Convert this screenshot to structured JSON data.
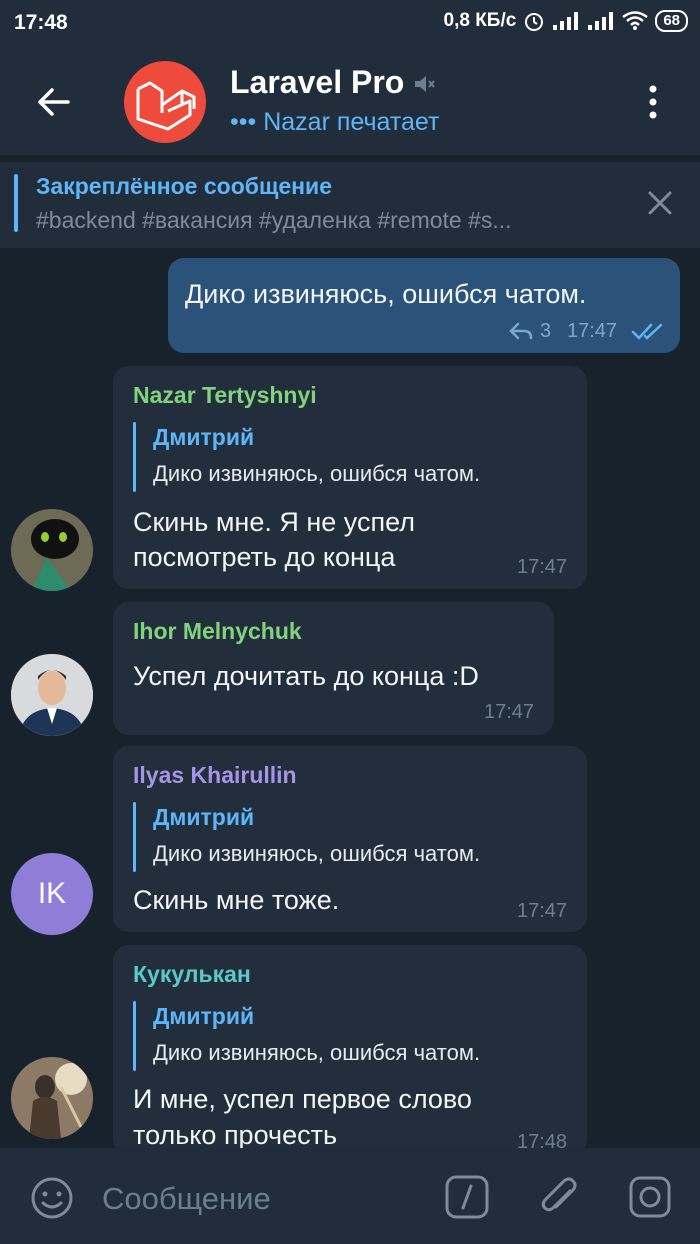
{
  "status_bar": {
    "time": "17:48",
    "net_speed": "0,8 КБ/с",
    "battery": "68"
  },
  "header": {
    "title": "Laravel Pro",
    "status": "••• Nazar печатает"
  },
  "pinned": {
    "title": "Закреплённое сообщение",
    "text": "#backend #вакансия #удаленка #remote #s..."
  },
  "messages": [
    {
      "direction": "out",
      "text": "Дико извиняюсь, ошибся чатом.",
      "replies_count": "3",
      "time": "17:47"
    },
    {
      "direction": "in",
      "sender": "Nazar Tertyshnyi",
      "sender_color": "#82d37d",
      "reply_to_name": "Дмитрий",
      "reply_to_text": "Дико извиняюсь, ошибся чатом.",
      "text_line1": "Скинь мне. Я не успел",
      "text_line2": "посмотреть до конца",
      "time": "17:47"
    },
    {
      "direction": "in",
      "sender": "Ihor Melnychuk",
      "sender_color": "#82d37d",
      "text": "Успел дочитать до конца :D",
      "time": "17:47"
    },
    {
      "direction": "in",
      "sender": "Ilyas Khairullin",
      "sender_color": "#a695e7",
      "avatar_initials": "IK",
      "avatar_color": "#8e7ed8",
      "reply_to_name": "Дмитрий",
      "reply_to_text": "Дико извиняюсь, ошибся чатом.",
      "text": "Скинь мне тоже.",
      "time": "17:47"
    },
    {
      "direction": "in",
      "sender": "Кукулькан",
      "sender_color": "#5cc9c9",
      "reply_to_name": "Дмитрий",
      "reply_to_text": "Дико извиняюсь, ошибся чатом.",
      "text_line1": "И мне, успел первое слово",
      "text_line2": "только прочесть",
      "time": "17:48"
    }
  ],
  "input": {
    "placeholder": "Сообщение"
  },
  "colors": {
    "background": "#18222d",
    "header": "#212d3b",
    "incoming_bubble": "#232e3c",
    "outgoing_bubble": "#2b5278",
    "accent": "#5eb5f7"
  }
}
